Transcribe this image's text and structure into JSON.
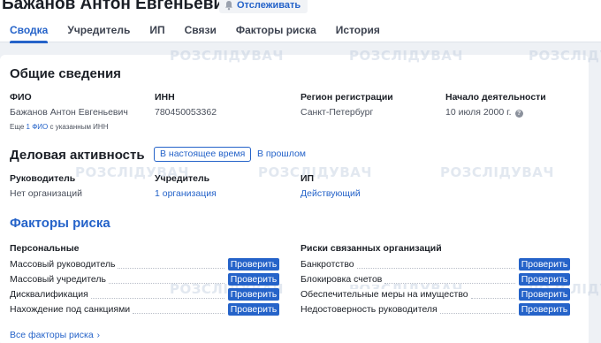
{
  "header": {
    "person_name": "Бажанов Антон Евгеньевич",
    "follow_label": "Отслеживать",
    "tabs": [
      {
        "label": "Сводка",
        "active": true
      },
      {
        "label": "Учредитель",
        "active": false
      },
      {
        "label": "ИП",
        "active": false
      },
      {
        "label": "Связи",
        "active": false
      },
      {
        "label": "Факторы риска",
        "active": false
      },
      {
        "label": "История",
        "active": false
      }
    ]
  },
  "general": {
    "title": "Общие сведения",
    "fio_label": "ФИО",
    "fio_value": "Бажанов Антон Евгеньевич",
    "more_prefix": "Еще",
    "more_link": "1 ФИО",
    "more_suffix": "с указанным ИНН",
    "inn_label": "ИНН",
    "inn_value": "780450053362",
    "region_label": "Регион регистрации",
    "region_value": "Санкт-Петербург",
    "start_label": "Начало деятельности",
    "start_value": "10 июля 2000 г.",
    "help_glyph": "?"
  },
  "business": {
    "title": "Деловая активность",
    "filter_current": "В настоящее время",
    "filter_past": "В прошлом",
    "head_label": "Руководитель",
    "head_value": "Нет организаций",
    "founder_label": "Учредитель",
    "founder_value": "1 организация",
    "ip_label": "ИП",
    "ip_value": "Действующий"
  },
  "risks": {
    "title": "Факторы риска",
    "personal_label": "Персональные",
    "related_label": "Риски связанных организаций",
    "check_label": "Проверить",
    "personal": [
      "Массовый руководитель",
      "Массовый учредитель",
      "Дисквалификация",
      "Нахождение под санкциями"
    ],
    "related": [
      "Банкротство",
      "Блокировка счетов",
      "Обеспечительные меры на имущество",
      "Недостоверность руководителя"
    ],
    "all_link": "Все факторы риска",
    "chevron": "›"
  },
  "watermark": "РОЗСЛІДУВАЧ",
  "colors": {
    "accent": "#2563c9",
    "text": "#1b1f26",
    "muted": "#4a505c",
    "page_bg": "#eef1f5"
  }
}
